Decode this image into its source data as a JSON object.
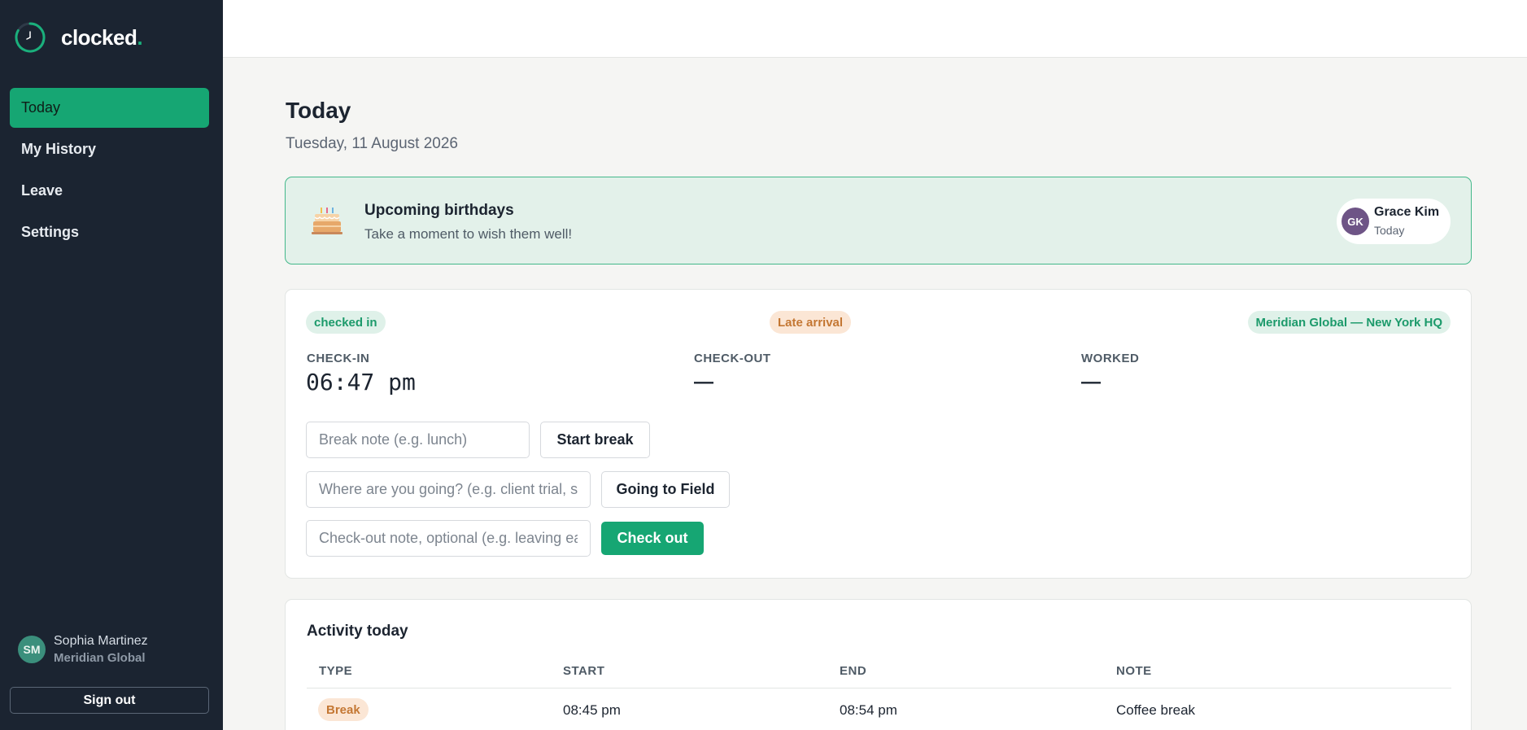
{
  "app": {
    "brand_name": "clocked",
    "brand_dot": ".",
    "accent": "#16a673"
  },
  "sidebar": {
    "nav": [
      {
        "label": "Today",
        "active": true
      },
      {
        "label": "My History",
        "active": false
      },
      {
        "label": "Leave",
        "active": false
      },
      {
        "label": "Settings",
        "active": false
      }
    ],
    "user": {
      "initials": "SM",
      "name": "Sophia Martinez",
      "org": "Meridian Global"
    },
    "sign_out_label": "Sign out"
  },
  "page": {
    "title": "Today",
    "date": "Tuesday, 11 August 2026"
  },
  "birthdays": {
    "icon": "cake-icon",
    "title": "Upcoming birthdays",
    "subtitle": "Take a moment to wish them well!",
    "people": [
      {
        "initials": "GK",
        "name": "Grace Kim",
        "when": "Today"
      }
    ]
  },
  "status": {
    "state_badge": "checked in",
    "late_badge": "Late arrival",
    "location_badge": "Meridian Global — New York HQ",
    "check_in_label": "CHECK-IN",
    "check_in_value": "06:47 pm",
    "check_out_label": "CHECK-OUT",
    "check_out_value": "—",
    "worked_label": "WORKED",
    "worked_value": "—",
    "break_placeholder": "Break note (e.g. lunch)",
    "break_button": "Start break",
    "field_placeholder": "Where are you going? (e.g. client trial, site visit)",
    "field_button": "Going to Field",
    "checkout_placeholder": "Check-out note, optional (e.g. leaving early)",
    "checkout_button": "Check out"
  },
  "activity": {
    "title": "Activity today",
    "columns": [
      "TYPE",
      "START",
      "END",
      "NOTE"
    ],
    "rows": [
      {
        "type": "Break",
        "start": "08:45 pm",
        "end": "08:54 pm",
        "note": "Coffee break"
      }
    ]
  }
}
